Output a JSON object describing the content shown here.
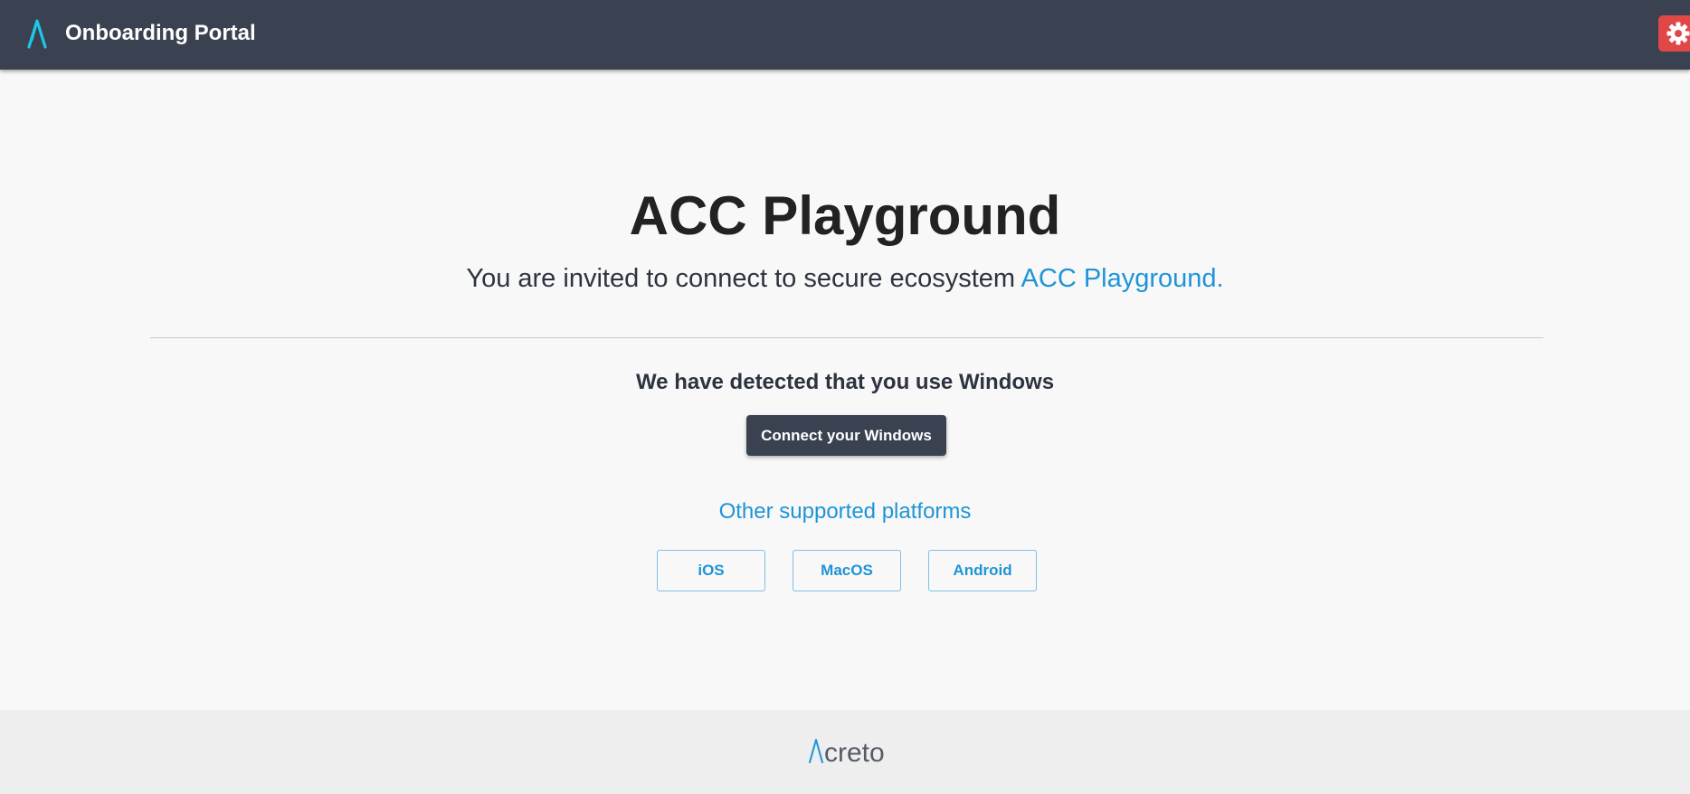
{
  "header": {
    "title": "Onboarding Portal",
    "logo_icon": "acreto-a-logo-icon",
    "settings_icon": "gear-icon",
    "accent_color": "#1ec6e8",
    "background_color": "#3a4150",
    "settings_button_color": "#e04848"
  },
  "main": {
    "title": "ACC Playground",
    "invite_text": "You are invited to connect to secure ecosystem ",
    "invite_link": "ACC Playground.",
    "detected_text": "We have detected that you use Windows",
    "connect_button": "Connect your Windows",
    "other_platforms": "Other supported platforms",
    "platforms": [
      {
        "label": "iOS"
      },
      {
        "label": "MacOS"
      },
      {
        "label": "Android"
      }
    ],
    "link_color": "#1e94d8"
  },
  "footer": {
    "logo_text": "creto",
    "logo_icon": "acreto-logo-icon"
  }
}
